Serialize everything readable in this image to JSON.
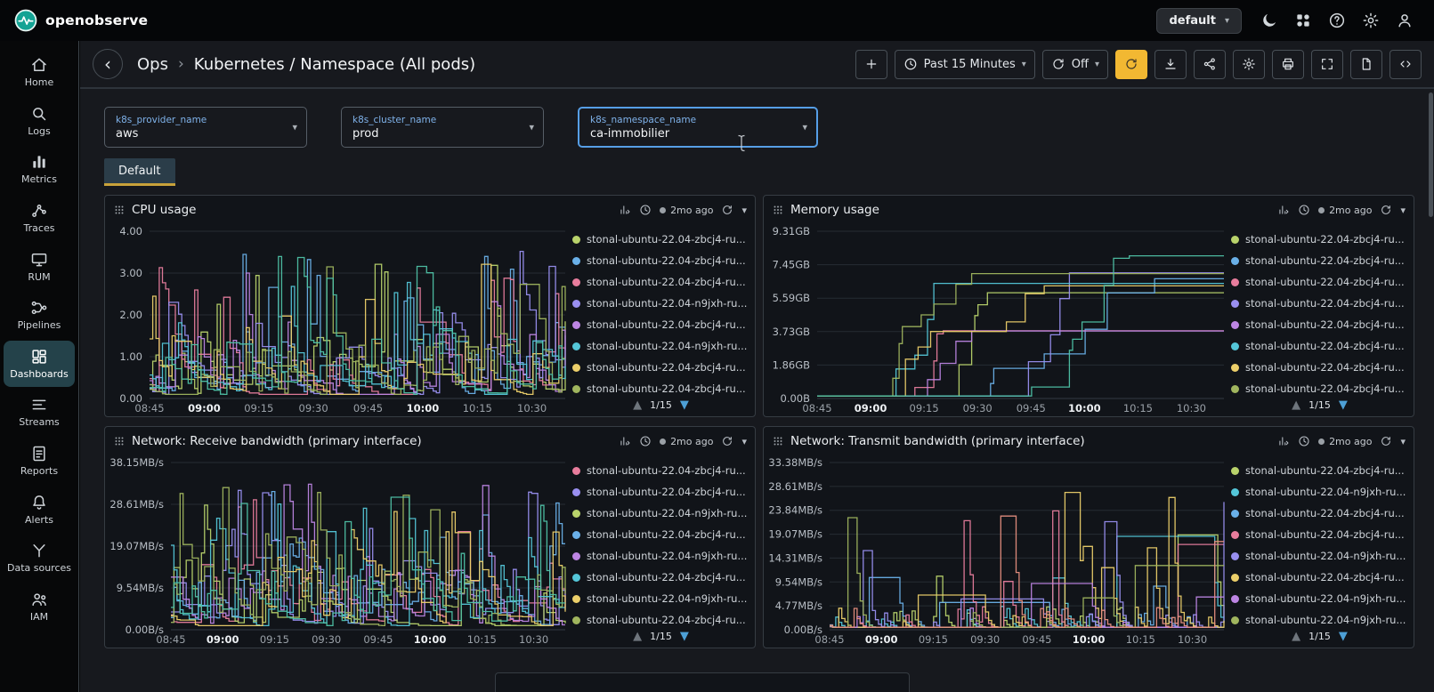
{
  "topbar": {
    "brand": "openobserve",
    "org": "default",
    "icon_buttons": [
      {
        "id": "dark-mode-toggle",
        "icon": "moon"
      },
      {
        "id": "apps",
        "icon": "apps"
      },
      {
        "id": "help",
        "icon": "help"
      },
      {
        "id": "settings",
        "icon": "gear"
      },
      {
        "id": "profile",
        "icon": "user"
      }
    ]
  },
  "sidebar": {
    "items": [
      {
        "id": "home",
        "label": "Home",
        "icon": "home",
        "active": false
      },
      {
        "id": "logs",
        "label": "Logs",
        "icon": "search",
        "active": false
      },
      {
        "id": "metrics",
        "label": "Metrics",
        "icon": "metrics",
        "active": false
      },
      {
        "id": "traces",
        "label": "Traces",
        "icon": "traces",
        "active": false
      },
      {
        "id": "rum",
        "label": "RUM",
        "icon": "rum",
        "active": false
      },
      {
        "id": "pipelines",
        "label": "Pipelines",
        "icon": "pipelines",
        "active": false
      },
      {
        "id": "dashboards",
        "label": "Dashboards",
        "icon": "dashboards",
        "active": true
      },
      {
        "id": "streams",
        "label": "Streams",
        "icon": "streams",
        "active": false
      },
      {
        "id": "reports",
        "label": "Reports",
        "icon": "reports",
        "active": false
      },
      {
        "id": "alerts",
        "label": "Alerts",
        "icon": "alerts",
        "active": false
      },
      {
        "id": "data-sources",
        "label": "Data sources",
        "icon": "datasources",
        "active": false
      },
      {
        "id": "iam",
        "label": "IAM",
        "icon": "iam",
        "active": false
      }
    ]
  },
  "header": {
    "breadcrumb": {
      "root": "Ops",
      "sep": "›",
      "current": "Kubernetes / Namespace (All pods)"
    },
    "time_range": "Past 15 Minutes",
    "refresh_interval": "Off",
    "icon_buttons": [
      {
        "id": "export-dashboard",
        "icon": "download"
      },
      {
        "id": "share-dashboard",
        "icon": "share"
      },
      {
        "id": "dashboard-settings",
        "icon": "gear"
      },
      {
        "id": "print-dashboard",
        "icon": "printer"
      },
      {
        "id": "fullscreen",
        "icon": "fullscreen"
      },
      {
        "id": "view-json",
        "icon": "file"
      },
      {
        "id": "query-inspector",
        "icon": "code"
      }
    ]
  },
  "filters": [
    {
      "label": "k8s_provider_name",
      "value": "aws",
      "focused": false
    },
    {
      "label": "k8s_cluster_name",
      "value": "prod",
      "focused": false
    },
    {
      "label": "k8s_namespace_name",
      "value": "ca-immobilier",
      "focused": true
    }
  ],
  "tabs": [
    {
      "label": "Default",
      "active": true
    }
  ],
  "panels": [
    {
      "title": "CPU usage",
      "last_refreshed": "2mo ago",
      "pager": "1/15",
      "chart": 0
    },
    {
      "title": "Memory usage",
      "last_refreshed": "2mo ago",
      "pager": "1/15",
      "chart": 1
    },
    {
      "title": "Network: Receive bandwidth (primary interface)",
      "last_refreshed": "2mo ago",
      "pager": "1/15",
      "chart": 2
    },
    {
      "title": "Network: Transmit bandwidth (primary interface)",
      "last_refreshed": "2mo ago",
      "pager": "1/15",
      "chart": 3
    }
  ],
  "chart_data": [
    {
      "panel": "CPU usage",
      "type": "line",
      "style": "spiky",
      "ylim": [
        0,
        4
      ],
      "y_label_width": 50,
      "y_ticks": [
        "0.00",
        "1.00",
        "2.00",
        "3.00",
        "4.00"
      ],
      "x_ticks": [
        "08:45",
        "09:00",
        "09:15",
        "09:30",
        "09:45",
        "10:00",
        "10:15",
        "10:30"
      ],
      "x_ticks_bold": [
        "09:00",
        "10:00"
      ],
      "legend_position": "right",
      "series": [
        {
          "name": "stonal-ubuntu-22.04-zbcj4-ru...",
          "color": "#b9d36b"
        },
        {
          "name": "stonal-ubuntu-22.04-zbcj4-ru...",
          "color": "#6ab0e8"
        },
        {
          "name": "stonal-ubuntu-22.04-zbcj4-ru...",
          "color": "#e87d9d"
        },
        {
          "name": "stonal-ubuntu-22.04-n9jxh-ru...",
          "color": "#998ff0"
        },
        {
          "name": "stonal-ubuntu-22.04-zbcj4-ru...",
          "color": "#bd85e3"
        },
        {
          "name": "stonal-ubuntu-22.04-n9jxh-ru...",
          "color": "#54c6d8"
        },
        {
          "name": "stonal-ubuntu-22.04-zbcj4-ru...",
          "color": "#eccf6a"
        },
        {
          "name": "stonal-ubuntu-22.04-zbcj4-ru...",
          "color": "#a0b55e"
        },
        {
          "name": "stonal-ubuntu-22.04-zbcj4-ru...",
          "color": "#4fc2a6"
        }
      ]
    },
    {
      "panel": "Memory usage",
      "type": "line",
      "style": "ramp",
      "ylim_labels": [
        "0.00B",
        "9.31GB"
      ],
      "y_label_width": 60,
      "y_ticks": [
        "0.00B",
        "1.86GB",
        "3.73GB",
        "5.59GB",
        "7.45GB",
        "9.31GB"
      ],
      "x_ticks": [
        "08:45",
        "09:00",
        "09:15",
        "09:30",
        "09:45",
        "10:00",
        "10:15",
        "10:30"
      ],
      "x_ticks_bold": [
        "09:00",
        "10:00"
      ],
      "legend_position": "right",
      "series": [
        {
          "name": "stonal-ubuntu-22.04-zbcj4-ru...",
          "color": "#b9d36b"
        },
        {
          "name": "stonal-ubuntu-22.04-zbcj4-ru...",
          "color": "#6ab0e8"
        },
        {
          "name": "stonal-ubuntu-22.04-zbcj4-ru...",
          "color": "#e87d9d"
        },
        {
          "name": "stonal-ubuntu-22.04-zbcj4-ru...",
          "color": "#998ff0"
        },
        {
          "name": "stonal-ubuntu-22.04-zbcj4-ru...",
          "color": "#bd85e3"
        },
        {
          "name": "stonal-ubuntu-22.04-zbcj4-ru...",
          "color": "#54c6d8"
        },
        {
          "name": "stonal-ubuntu-22.04-zbcj4-ru...",
          "color": "#eccf6a"
        },
        {
          "name": "stonal-ubuntu-22.04-zbcj4-ru...",
          "color": "#a0b55e"
        },
        {
          "name": "stonal-ubuntu-22.04-zbcj4-ru...",
          "color": "#4fc2a6"
        }
      ]
    },
    {
      "panel": "Network: Receive bandwidth (primary interface)",
      "type": "line",
      "style": "spiky",
      "ylim_labels": [
        "0.00B/s",
        "38.15MB/s"
      ],
      "y_label_width": 74,
      "y_ticks": [
        "0.00B/s",
        "9.54MB/s",
        "19.07MB/s",
        "28.61MB/s",
        "38.15MB/s"
      ],
      "x_ticks": [
        "08:45",
        "09:00",
        "09:15",
        "09:30",
        "09:45",
        "10:00",
        "10:15",
        "10:30"
      ],
      "x_ticks_bold": [
        "09:00",
        "10:00"
      ],
      "legend_position": "right",
      "series": [
        {
          "name": "stonal-ubuntu-22.04-zbcj4-ru...",
          "color": "#e87d9d"
        },
        {
          "name": "stonal-ubuntu-22.04-zbcj4-ru...",
          "color": "#998ff0"
        },
        {
          "name": "stonal-ubuntu-22.04-n9jxh-ru...",
          "color": "#b9d36b"
        },
        {
          "name": "stonal-ubuntu-22.04-zbcj4-ru...",
          "color": "#6ab0e8"
        },
        {
          "name": "stonal-ubuntu-22.04-n9jxh-ru...",
          "color": "#bd85e3"
        },
        {
          "name": "stonal-ubuntu-22.04-zbcj4-ru...",
          "color": "#54c6d8"
        },
        {
          "name": "stonal-ubuntu-22.04-n9jxh-ru...",
          "color": "#eccf6a"
        },
        {
          "name": "stonal-ubuntu-22.04-zbcj4-ru...",
          "color": "#a0b55e"
        },
        {
          "name": "stonal-ubuntu-22.04-n9jxh-ru...",
          "color": "#4fc2a6"
        }
      ]
    },
    {
      "panel": "Network: Transmit bandwidth (primary interface)",
      "type": "line",
      "style": "sparse",
      "ylim_labels": [
        "0.00B/s",
        "33.38MB/s"
      ],
      "y_label_width": 74,
      "y_ticks": [
        "0.00B/s",
        "4.77MB/s",
        "9.54MB/s",
        "14.31MB/s",
        "19.07MB/s",
        "23.84MB/s",
        "28.61MB/s",
        "33.38MB/s"
      ],
      "x_ticks": [
        "08:45",
        "09:00",
        "09:15",
        "09:30",
        "09:45",
        "10:00",
        "10:15",
        "10:30"
      ],
      "x_ticks_bold": [
        "09:00",
        "10:00"
      ],
      "legend_position": "right",
      "series": [
        {
          "name": "stonal-ubuntu-22.04-zbcj4-ru...",
          "color": "#b9d36b"
        },
        {
          "name": "stonal-ubuntu-22.04-n9jxh-ru...",
          "color": "#54c6d8"
        },
        {
          "name": "stonal-ubuntu-22.04-zbcj4-ru...",
          "color": "#6ab0e8"
        },
        {
          "name": "stonal-ubuntu-22.04-zbcj4-ru...",
          "color": "#e87d9d"
        },
        {
          "name": "stonal-ubuntu-22.04-n9jxh-ru...",
          "color": "#998ff0"
        },
        {
          "name": "stonal-ubuntu-22.04-zbcj4-ru...",
          "color": "#eccf6a"
        },
        {
          "name": "stonal-ubuntu-22.04-n9jxh-ru...",
          "color": "#bd85e3"
        },
        {
          "name": "stonal-ubuntu-22.04-n9jxh-ru...",
          "color": "#a0b55e"
        },
        {
          "name": "stonal-ubuntu-22.04-n9jxh-ru...",
          "color": "#e88f7f"
        }
      ]
    }
  ]
}
